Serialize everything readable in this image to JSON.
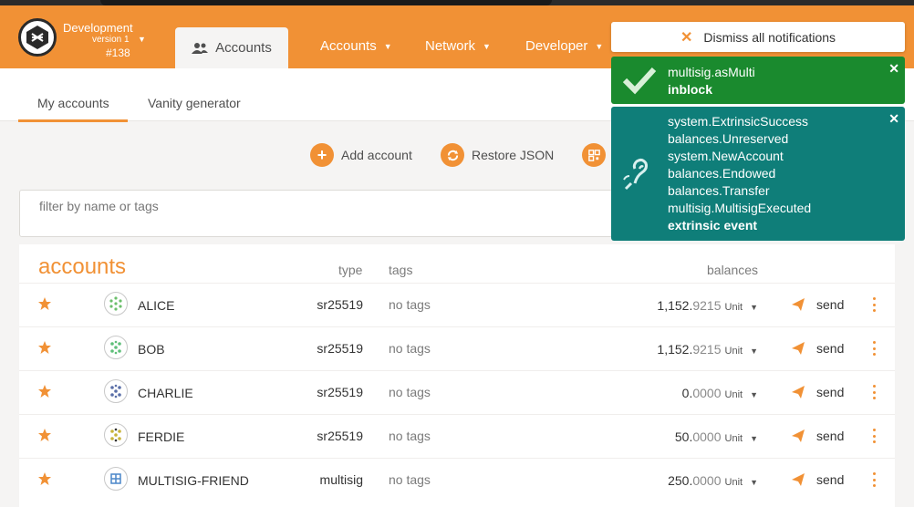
{
  "chain": {
    "name": "Development",
    "version": "version 1",
    "block": "#138"
  },
  "nav": {
    "active_tab": "Accounts",
    "menus": [
      {
        "label": "Accounts"
      },
      {
        "label": "Network"
      },
      {
        "label": "Developer"
      }
    ]
  },
  "subtabs": {
    "my_accounts": "My accounts",
    "vanity": "Vanity generator"
  },
  "actions": {
    "add_account": "Add account",
    "restore_json": "Restore JSON"
  },
  "filter": {
    "placeholder": "filter by name or tags"
  },
  "table": {
    "title": "accounts",
    "headers": {
      "type": "type",
      "tags": "tags",
      "balances": "balances"
    },
    "rows": [
      {
        "name": "ALICE",
        "type": "sr25519",
        "tags": "no tags",
        "balance_int": "1,152.",
        "balance_dec": "9215",
        "unit": "Unit",
        "send": "send"
      },
      {
        "name": "BOB",
        "type": "sr25519",
        "tags": "no tags",
        "balance_int": "1,152.",
        "balance_dec": "9215",
        "unit": "Unit",
        "send": "send"
      },
      {
        "name": "CHARLIE",
        "type": "sr25519",
        "tags": "no tags",
        "balance_int": "0.",
        "balance_dec": "0000",
        "unit": "Unit",
        "send": "send"
      },
      {
        "name": "FERDIE",
        "type": "sr25519",
        "tags": "no tags",
        "balance_int": "50.",
        "balance_dec": "0000",
        "unit": "Unit",
        "send": "send"
      },
      {
        "name": "MULTISIG-FRIEND",
        "type": "multisig",
        "tags": "no tags",
        "balance_int": "250.",
        "balance_dec": "0000",
        "unit": "Unit",
        "send": "send"
      }
    ]
  },
  "notifications": {
    "dismiss_label": "Dismiss all notifications",
    "items": [
      {
        "lines": [
          "multisig.asMulti"
        ],
        "status": "inblock",
        "color": "#1a8a2e"
      },
      {
        "lines": [
          "system.ExtrinsicSuccess",
          "balances.Unreserved",
          "system.NewAccount",
          "balances.Endowed",
          "balances.Transfer",
          "multisig.MultisigExecuted"
        ],
        "status": "extrinsic event",
        "color": "#0f7e79"
      }
    ]
  },
  "colors": {
    "accent": "#f19135",
    "success": "#1a8a2e",
    "event": "#0f7e79"
  }
}
